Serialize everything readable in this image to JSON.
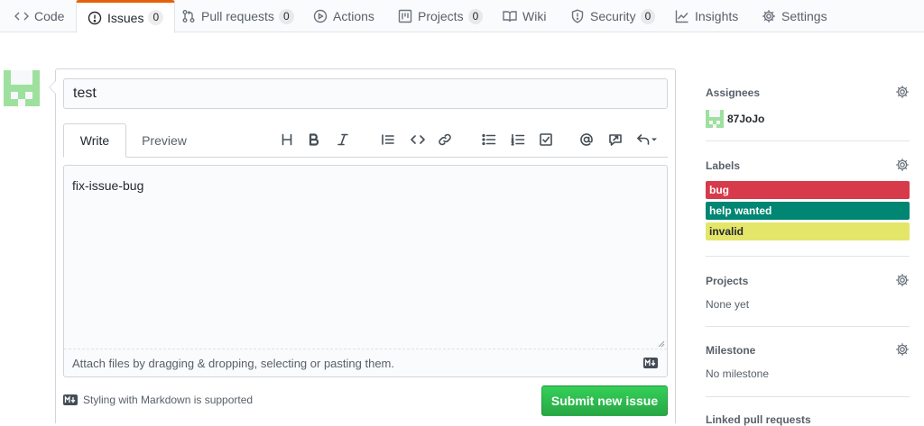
{
  "nav": {
    "tabs": [
      {
        "label": "Code"
      },
      {
        "label": "Issues",
        "count": "0"
      },
      {
        "label": "Pull requests",
        "count": "0"
      },
      {
        "label": "Actions"
      },
      {
        "label": "Projects",
        "count": "0"
      },
      {
        "label": "Wiki"
      },
      {
        "label": "Security",
        "count": "0"
      },
      {
        "label": "Insights"
      },
      {
        "label": "Settings"
      }
    ],
    "selected": "Issues"
  },
  "compose": {
    "title_value": "test",
    "tabs": [
      {
        "label": "Write"
      },
      {
        "label": "Preview"
      }
    ],
    "active_tab": "Write",
    "toolbar_icons": [
      "heading-icon",
      "bold-icon",
      "italic-icon",
      "quote-icon",
      "code-icon",
      "link-icon",
      "bullet-list-icon",
      "numbered-list-icon",
      "task-list-icon",
      "mention-icon",
      "reference-icon",
      "reply-icon"
    ],
    "body_value": "fix-issue-bug",
    "attach_hint": "Attach files by dragging & dropping, selecting or pasting them.",
    "markdown_note": "Styling with Markdown is supported",
    "submit_label": "Submit new issue"
  },
  "sidebar": {
    "assignees": {
      "heading": "Assignees",
      "user": "87JoJo"
    },
    "labels": {
      "heading": "Labels",
      "items": [
        {
          "name": "bug",
          "color": "#d73a4a",
          "text_color": "#ffffff"
        },
        {
          "name": "help wanted",
          "color": "#008672",
          "text_color": "#ffffff"
        },
        {
          "name": "invalid",
          "color": "#e4e669",
          "text_color": "#24292e"
        }
      ]
    },
    "projects": {
      "heading": "Projects",
      "value": "None yet"
    },
    "milestone": {
      "heading": "Milestone",
      "value": "No milestone"
    },
    "linked_heading": "Linked pull requests"
  },
  "colors": {
    "accent": "#e36209",
    "submit_green": "#2cbe4e",
    "avatar_green": "#9ee09e"
  }
}
